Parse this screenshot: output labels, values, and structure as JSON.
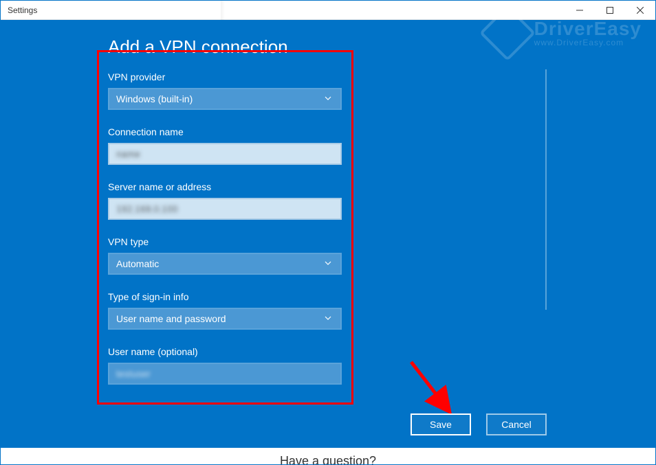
{
  "window": {
    "title": "Settings",
    "footer_question": "Have a question?"
  },
  "watermark": {
    "brand_bold": "Driver",
    "brand_light": "Easy",
    "url": "www.DriverEasy.com"
  },
  "page": {
    "heading": "Add a VPN connection"
  },
  "form": {
    "vpn_provider": {
      "label": "VPN provider",
      "value": "Windows (built-in)"
    },
    "connection_name": {
      "label": "Connection name",
      "value": "name"
    },
    "server": {
      "label": "Server name or address",
      "value": "192.168.0.100"
    },
    "vpn_type": {
      "label": "VPN type",
      "value": "Automatic"
    },
    "signin": {
      "label": "Type of sign-in info",
      "value": "User name and password"
    },
    "username": {
      "label": "User name (optional)",
      "value": "testuser"
    }
  },
  "buttons": {
    "save": "Save",
    "cancel": "Cancel"
  }
}
